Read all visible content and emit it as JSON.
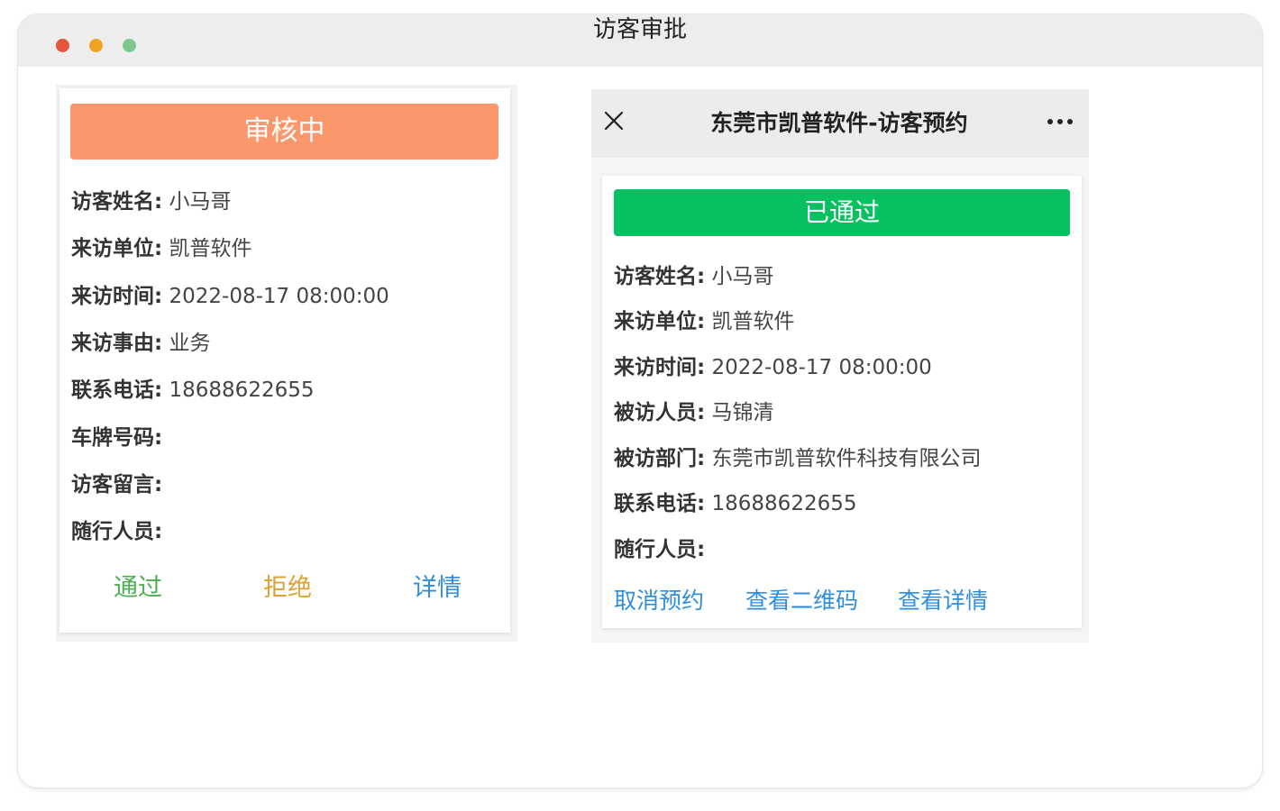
{
  "window": {
    "title": "访客审批"
  },
  "left_card": {
    "status": "审核中",
    "status_color": "#fb976a",
    "fields": [
      {
        "label": "访客姓名:",
        "value": "小马哥"
      },
      {
        "label": "来访单位:",
        "value": "凯普软件"
      },
      {
        "label": "来访时间:",
        "value": "2022-08-17 08:00:00"
      },
      {
        "label": "来访事由:",
        "value": "业务"
      },
      {
        "label": "联系电话:",
        "value": "18688622655"
      },
      {
        "label": "车牌号码:",
        "value": ""
      },
      {
        "label": "访客留言:",
        "value": ""
      },
      {
        "label": "随行人员:",
        "value": ""
      }
    ],
    "actions": {
      "approve": "通过",
      "reject": "拒绝",
      "details": "详情"
    },
    "action_colors": {
      "approve": "#4caf50",
      "reject": "#e0a030",
      "details": "#2f8ee0"
    }
  },
  "right_phone": {
    "nav_title": "东莞市凯普软件-访客预约",
    "close_icon": "close-icon",
    "more_icon": "more-icon",
    "status": "已通过",
    "status_color": "#07c160",
    "fields": [
      {
        "label": "访客姓名:",
        "value": "小马哥"
      },
      {
        "label": "来访单位:",
        "value": "凯普软件"
      },
      {
        "label": "来访时间:",
        "value": "2022-08-17 08:00:00"
      },
      {
        "label": "被访人员:",
        "value": "马锦清"
      },
      {
        "label": "被访部门:",
        "value": "东莞市凯普软件科技有限公司"
      },
      {
        "label": "联系电话:",
        "value": "18688622655"
      },
      {
        "label": "随行人员:",
        "value": ""
      }
    ],
    "actions": {
      "cancel": "取消预约",
      "qr_code": "查看二维码",
      "details": "查看详情"
    },
    "action_color": "#2f8ee0"
  }
}
